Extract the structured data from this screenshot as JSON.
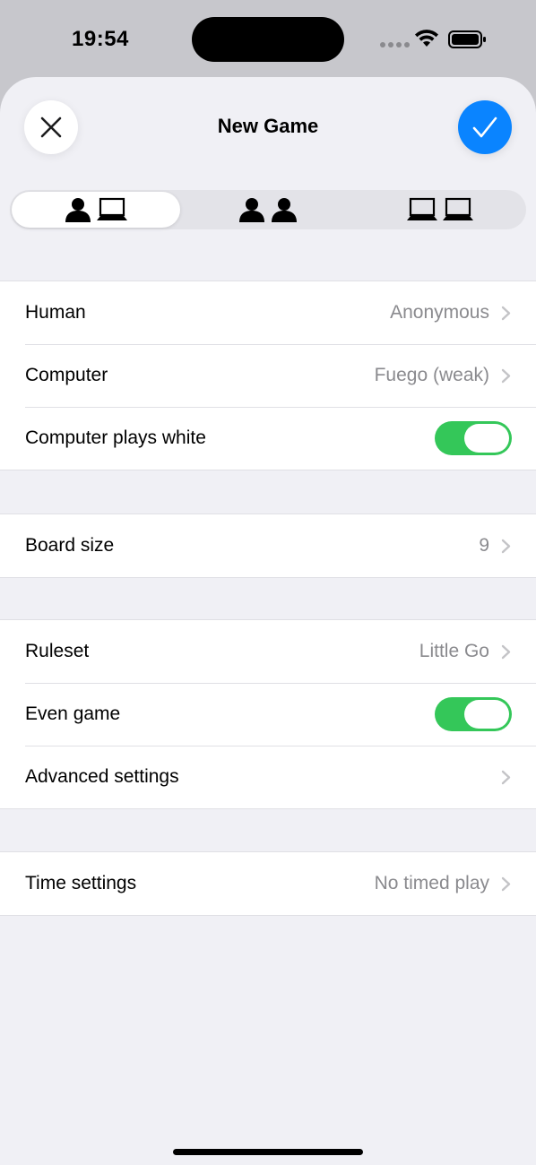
{
  "status_bar": {
    "time": "19:54"
  },
  "header": {
    "title": "New Game",
    "close_icon": "close-icon",
    "done_icon": "checkmark-icon",
    "accent_color": "#0a84ff"
  },
  "segmented": {
    "segments": [
      {
        "icons": [
          "person-icon",
          "laptop-icon"
        ],
        "selected": true
      },
      {
        "icons": [
          "person-icon",
          "person-icon"
        ],
        "selected": false
      },
      {
        "icons": [
          "laptop-icon",
          "laptop-icon"
        ],
        "selected": false
      }
    ]
  },
  "players": {
    "human_label": "Human",
    "human_value": "Anonymous",
    "computer_label": "Computer",
    "computer_value": "Fuego (weak)",
    "computer_plays_white_label": "Computer plays white",
    "computer_plays_white_on": true
  },
  "board": {
    "size_label": "Board size",
    "size_value": "9"
  },
  "rules": {
    "ruleset_label": "Ruleset",
    "ruleset_value": "Little Go",
    "even_game_label": "Even game",
    "even_game_on": true,
    "advanced_label": "Advanced settings"
  },
  "time": {
    "label": "Time settings",
    "value": "No timed play"
  },
  "colors": {
    "toggle_on": "#34c759",
    "secondary_text": "#8a8a8e",
    "background": "#f0f0f5"
  }
}
